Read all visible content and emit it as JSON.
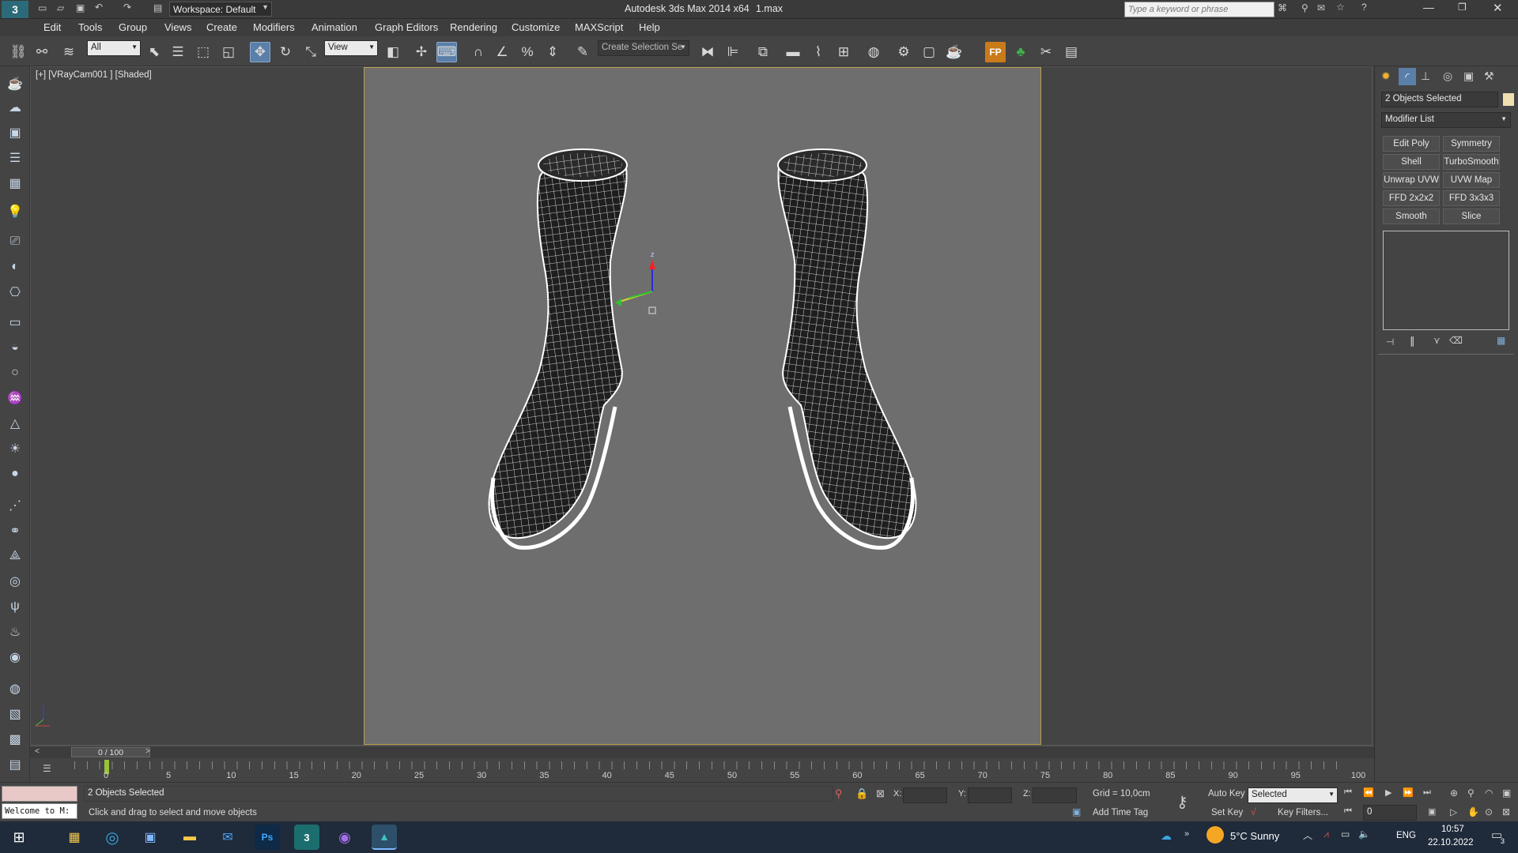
{
  "titlebar": {
    "workspace_label": "Workspace: Default",
    "app_title": "Autodesk 3ds Max  2014 x64",
    "file_name": "1.max",
    "search_placeholder": "Type a keyword or phrase"
  },
  "menubar": {
    "items": [
      "Edit",
      "Tools",
      "Group",
      "Views",
      "Create",
      "Modifiers",
      "Animation",
      "Graph Editors",
      "Rendering",
      "Customize",
      "MAXScript",
      "Help"
    ]
  },
  "toolbar": {
    "filter_value": "All",
    "refcoord_value": "View",
    "selection_set_placeholder": "Create Selection Se"
  },
  "viewport": {
    "label": "[+] [VRayCam001 ] [Shaded]",
    "gizmo_axis_label": "z"
  },
  "command_panel": {
    "selection_text": "2 Objects Selected",
    "modifier_list_label": "Modifier List",
    "modifier_buttons": [
      "Edit Poly",
      "Symmetry",
      "Shell",
      "TurboSmooth",
      "Unwrap UVW",
      "UVW Map",
      "FFD 2x2x2",
      "FFD 3x3x3",
      "Smooth",
      "Slice"
    ]
  },
  "timeline": {
    "frame_counter": "0 / 100",
    "ticks": [
      "0",
      "5",
      "10",
      "15",
      "20",
      "25",
      "30",
      "35",
      "40",
      "45",
      "50",
      "55",
      "60",
      "65",
      "70",
      "75",
      "80",
      "85",
      "90",
      "95",
      "100"
    ]
  },
  "statusbar": {
    "maxscript_text": "Welcome to M:",
    "selection_status": "2 Objects Selected",
    "prompt_text": "Click and drag to select and move objects",
    "x_label": "X:",
    "y_label": "Y:",
    "z_label": "Z:",
    "grid_text": "Grid = 10,0cm",
    "add_time_tag": "Add Time Tag",
    "auto_key": "Auto Key",
    "set_key": "Set Key",
    "key_mode_value": "Selected",
    "key_filters": "Key Filters...",
    "current_frame": "0"
  },
  "taskbar": {
    "weather": "5°C  Sunny",
    "language": "ENG",
    "time": "10:57",
    "date": "22.10.2022",
    "notification_count": "3"
  },
  "colors": {
    "viewport_bg": "#6e6e6e",
    "safe_frame": "#b8a046",
    "active_tool": "#5a7fa8",
    "wire": "#ffffff"
  }
}
